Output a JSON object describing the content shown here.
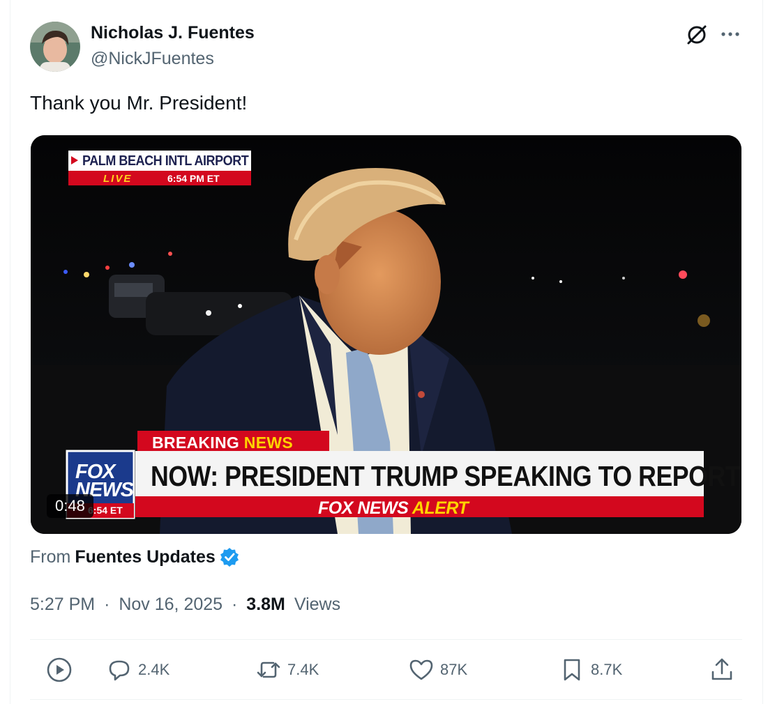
{
  "author": {
    "name": "Nicholas J. Fuentes",
    "handle": "@NickJFuentes",
    "avatar_icon": "profile-photo"
  },
  "header_icons": [
    "grok-icon",
    "more-icon"
  ],
  "tweet": {
    "text": "Thank you Mr. President!"
  },
  "video": {
    "duration": "0:48",
    "location": "PALM BEACH INTL AIRPORT",
    "live": "LIVE",
    "live_time": "6:54 PM ET",
    "breaking_word": "BREAKING",
    "breaking_accent": "NEWS",
    "headline": "NOW: PRESIDENT TRUMP SPEAKING TO REPORTERS",
    "alert_word": "FOX NEWS",
    "alert_accent": "ALERT",
    "logo_line1": "FOX",
    "logo_line2": "NEWS",
    "logo_time": "6:54 ET"
  },
  "source": {
    "prefix": "From",
    "name": "Fuentes Updates",
    "badge": "verified-icon"
  },
  "meta": {
    "time": "5:27 PM",
    "date": "Nov 16, 2025",
    "views_count": "3.8M",
    "views_label": "Views",
    "separator": "·"
  },
  "actions": {
    "replies": "2.4K",
    "reposts": "7.4K",
    "likes": "87K",
    "bookmarks": "8.7K"
  },
  "colors": {
    "text_primary": "#0f1419",
    "text_secondary": "#536471",
    "verified_blue": "#1d9bf0",
    "fox_red": "#d3081e",
    "fox_blue": "#1b3a8c",
    "news_yellow": "#ffd400"
  }
}
